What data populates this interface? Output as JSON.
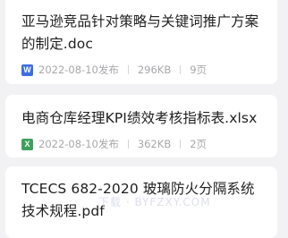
{
  "documents": [
    {
      "title": "亚马逊竞品针对策略与关键词推广方案的制定.doc",
      "icon": {
        "letter": "W",
        "name": "word-file-icon",
        "color": "#3b6fe0"
      },
      "date": "2022-08-10发布",
      "size": "296KB",
      "pages": "9页"
    },
    {
      "title": "电商仓库经理KPI绩效考核指标表.xlsx",
      "icon": {
        "letter": "X",
        "name": "excel-file-icon",
        "color": "#3ca05a"
      },
      "date": "2022-08-10发布",
      "size": "362KB",
      "pages": "2页"
    },
    {
      "title": "TCECS 682-2020 玻璃防火分隔系统技术规程.pdf"
    }
  ],
  "watermark": "下载 · BYFZXY.COM"
}
